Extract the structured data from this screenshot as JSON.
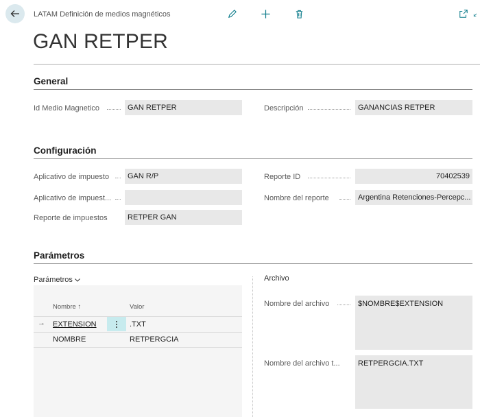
{
  "header": {
    "breadcrumb": "LATAM Definición de medios magnéticos",
    "title": "GAN RETPER",
    "actions": [
      "edit-icon",
      "new-icon",
      "delete-icon"
    ],
    "right_actions": [
      "open-in-new-window-icon",
      "collapse-icon"
    ]
  },
  "sections": {
    "general": {
      "title": "General",
      "fields": [
        {
          "label": "Id Medio Magnetico",
          "value": "GAN RETPER"
        },
        {
          "label": "Descripción",
          "value": "GANANCIAS RETPER"
        }
      ]
    },
    "configuracion": {
      "title": "Configuración",
      "left": [
        {
          "label": "Aplicativo de impuesto",
          "value": "GAN R/P"
        },
        {
          "label": "Aplicativo de impuest...",
          "value": ""
        },
        {
          "label": "Reporte de impuestos",
          "value": "RETPER GAN"
        }
      ],
      "right": [
        {
          "label": "Reporte ID",
          "value": "70402539"
        },
        {
          "label": "Nombre del reporte",
          "value": "Argentina Retenciones-Percepc..."
        }
      ]
    },
    "parametros": {
      "title": "Parámetros",
      "subpart_label": "Parámetros",
      "columns": [
        "Nombre",
        "Valor"
      ],
      "sort_indicator": "↑",
      "rows": [
        {
          "nombre": "EXTENSION",
          "valor": ".TXT",
          "selected": true
        },
        {
          "nombre": "NOMBRE",
          "valor": "RETPERGCIA",
          "selected": false
        }
      ],
      "archivo": {
        "title": "Archivo",
        "fields": [
          {
            "label": "Nombre del archivo",
            "value": "$NOMBRE$EXTENSION"
          },
          {
            "label": "Nombre del archivo t...",
            "value": "RETPERGCIA.TXT"
          }
        ]
      }
    }
  },
  "colors": {
    "accent": "#0f7d8c",
    "field_bg": "#e8e8e8",
    "selected_row": "#c7ebee",
    "back_button": "#dbe9ee"
  }
}
